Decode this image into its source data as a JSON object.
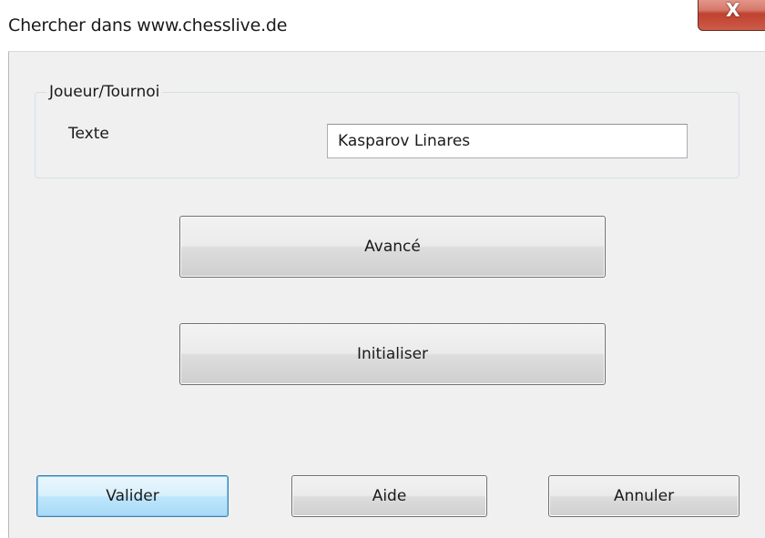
{
  "window": {
    "title": "Chercher dans www.chesslive.de",
    "close_glyph": "X"
  },
  "group": {
    "legend": "Joueur/Tournoi",
    "field_label": "Texte",
    "field_value": "Kasparov Linares"
  },
  "buttons": {
    "advanced": "Avancé",
    "reset": "Initialiser",
    "ok": "Valider",
    "help": "Aide",
    "cancel": "Annuler"
  },
  "icons": {
    "close": "close-icon"
  },
  "colors": {
    "close_button": "#c0412f",
    "dialog_background": "#f0f0f0",
    "default_button_border": "#3c7fb1"
  }
}
